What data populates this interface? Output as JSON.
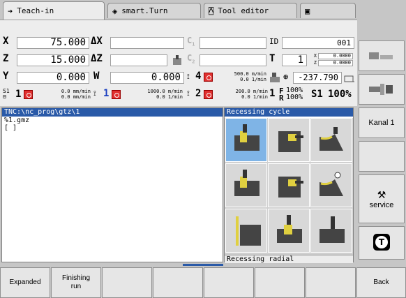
{
  "tabs": [
    {
      "label": "Teach-in",
      "icon": "arrow-right-icon"
    },
    {
      "label": "smart.Turn",
      "icon": "diamond-arrow-icon"
    },
    {
      "label": "Tool editor",
      "icon": "tool-icon"
    },
    {
      "label": "",
      "icon": "save-icon"
    }
  ],
  "status": {
    "x_label": "X",
    "x_value": "75.000",
    "dx_label": "ΔX",
    "z_label": "Z",
    "z_value": "15.000",
    "dz_label": "ΔZ",
    "y_label": "Y",
    "y_value": "0.000",
    "w_label": "W",
    "w_value": "0.000",
    "c1_label": "C",
    "c1_sub": "1",
    "c2_label": "C",
    "c2_sub": "2",
    "id_label": "ID",
    "id_value": "001",
    "t_label": "T",
    "t_value": "1",
    "tx_label": "X",
    "tx_value": "0.0000",
    "tz_label": "Z",
    "tz_value": "0.0000",
    "spindle4_num": "4",
    "spindle4_rate1": "500.0 m/min",
    "spindle4_rate2": "0.0 1/min",
    "angle_value": "-237.790",
    "s1_num": "1",
    "s1_rate1": "0.0 mm/min",
    "s1_rate2": "0.0 mm/min",
    "sp1_num": "1",
    "sp1_rate1": "1000.0 m/min",
    "sp1_rate2": "0.0 1/min",
    "sp2_num": "2",
    "sp2_rate1": "200.0 m/min",
    "sp2_rate2": "0.0 1/min",
    "feed_num": "1",
    "f_label": "F",
    "f_value": "100%",
    "r_label": "R",
    "r_value": "100%",
    "s1_label": "S1",
    "s1_pct": "100%"
  },
  "program": {
    "path": "TNC:\\nc_prog\\gtz\\1",
    "lines": [
      "%1.gmz",
      "[ ]"
    ]
  },
  "cycle": {
    "title": "Recessing cycle",
    "footer": "Recessing radial"
  },
  "right_softkeys": [
    "",
    "",
    "Kanal 1",
    "",
    "service",
    ""
  ],
  "bottom_softkeys": [
    "Expanded",
    "Finishing\nrun",
    "",
    "",
    "",
    "",
    "",
    "Back"
  ]
}
